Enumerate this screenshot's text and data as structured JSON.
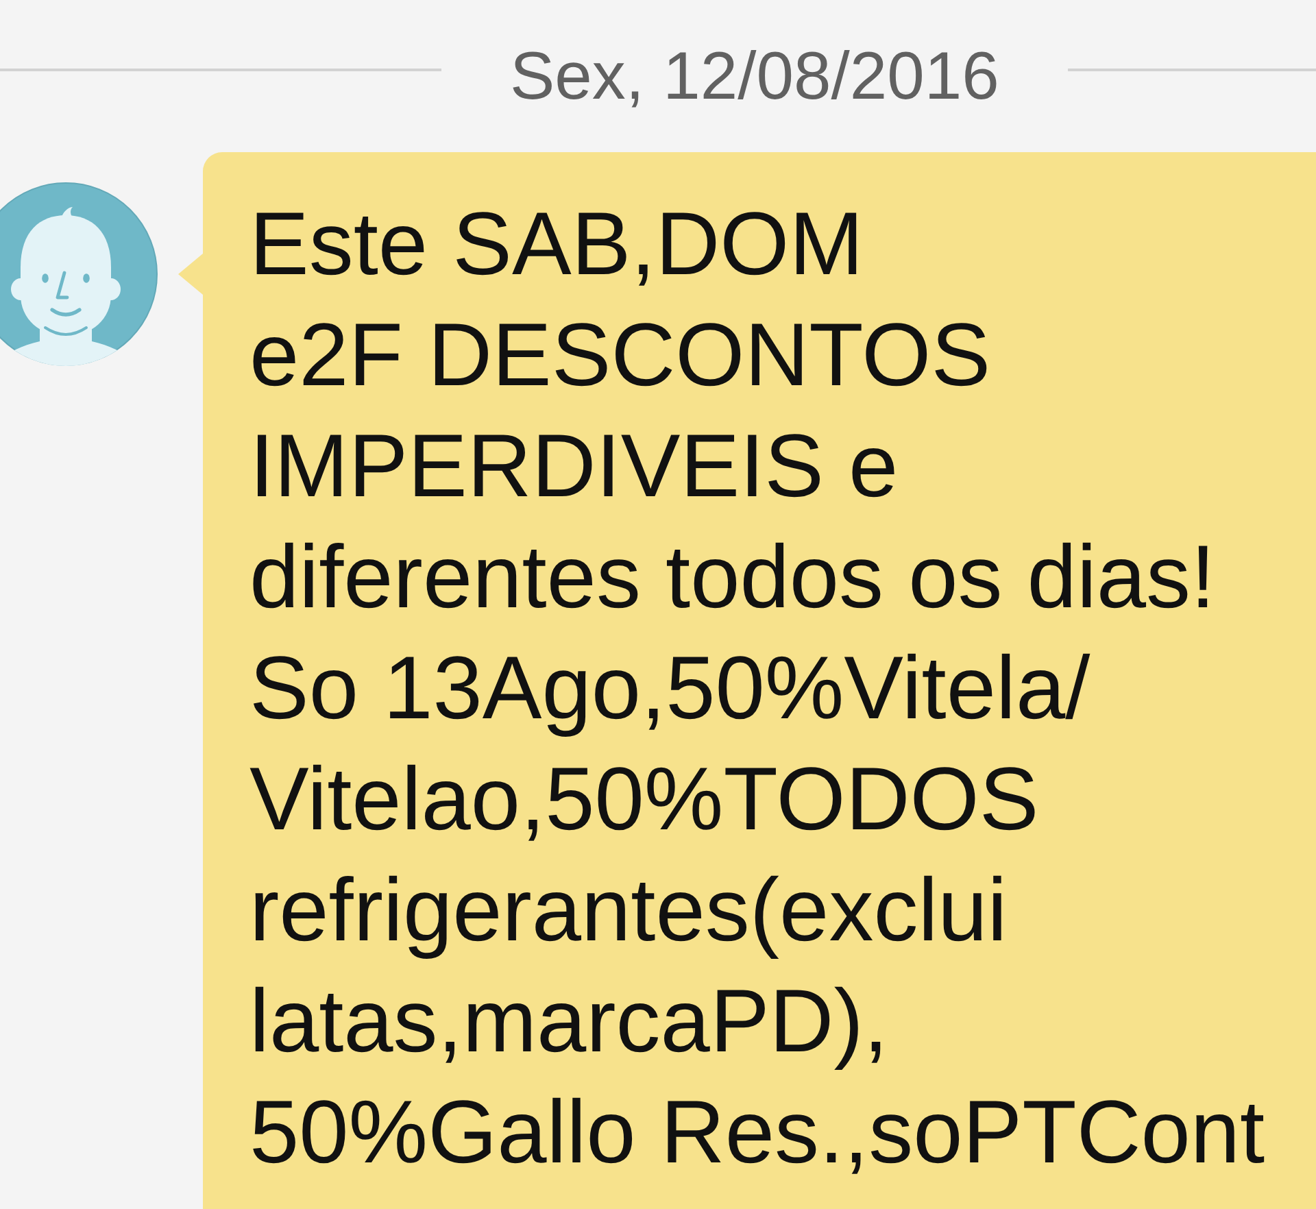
{
  "date_divider": {
    "label": "Sex, 12/08/2016"
  },
  "message": {
    "lines": [
      "Este SAB,DOM",
      "e2F DESCONTOS",
      "IMPERDIVEIS e",
      "diferentes todos os dias!",
      "So 13Ago,50%Vitela/",
      "Vitelao,50%TODOS",
      "refrigerantes(exclui",
      "latas,marcaPD),",
      "50%Gallo Res.,soPTCont"
    ]
  }
}
